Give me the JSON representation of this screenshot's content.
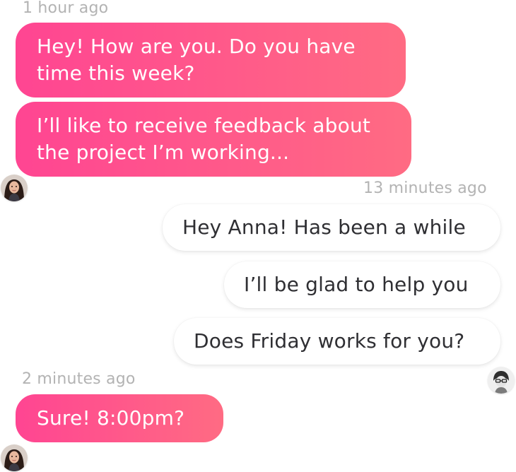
{
  "conversation": {
    "group1": {
      "timestamp": "1 hour ago",
      "messages": [
        "Hey! How are you. Do you have time this week?",
        "I’ll like to receive feedback about the project I’m working..."
      ],
      "avatar_icon": "user-avatar-anna"
    },
    "group2": {
      "timestamp": "13 minutes ago",
      "messages": [
        "Hey Anna! Has been a while",
        "I’ll be glad to help you",
        "Does Friday works for you?"
      ],
      "avatar_icon": "user-avatar-me"
    },
    "group3": {
      "timestamp": "2 minutes ago",
      "messages": [
        "Sure! 8:00pm?"
      ],
      "avatar_icon": "user-avatar-anna"
    }
  },
  "colors": {
    "incoming_gradient_start": "#ff4592",
    "incoming_gradient_end": "#ff6b83",
    "outgoing_bg": "#ffffff",
    "outgoing_text": "#2f2f33",
    "timestamp_text": "#b3b3b3"
  }
}
